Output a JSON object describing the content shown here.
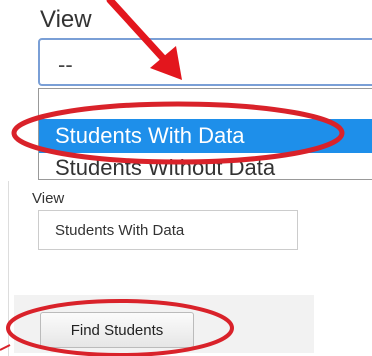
{
  "top_panel": {
    "view_label": "View",
    "select_value": "--",
    "options": [
      "Students With Data",
      "Students Without Data"
    ]
  },
  "bottom_panel": {
    "view_label": "View",
    "select_value": "Students With Data",
    "find_button_label": "Find Students"
  },
  "annotations": {
    "arrow_color": "#e3161d",
    "highlight_color": "#d9222a"
  },
  "colors": {
    "selection": "#1e8fea",
    "select_border": "#7a9fd6"
  }
}
